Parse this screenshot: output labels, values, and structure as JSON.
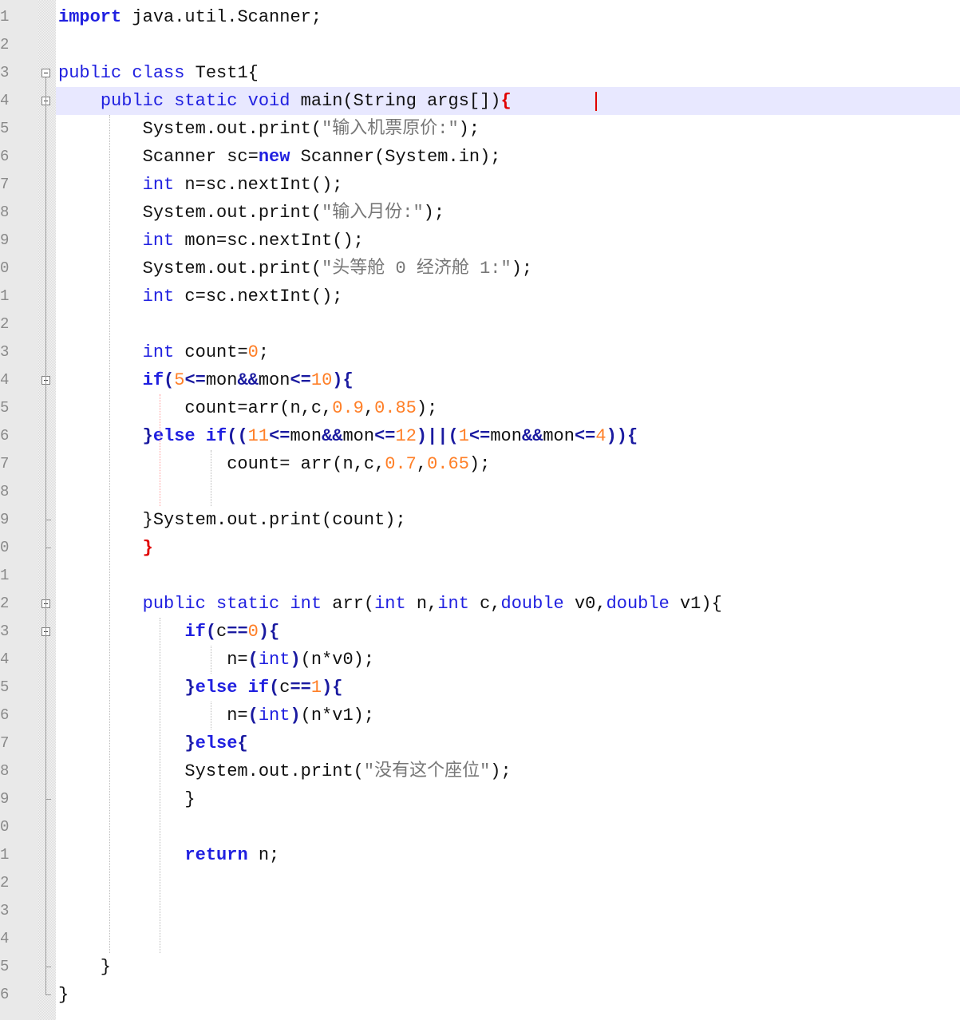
{
  "editor": {
    "current_line": 4,
    "lines": [
      {
        "n": "1",
        "tokens": [
          [
            "kw",
            "import"
          ],
          [
            "plain",
            " java.util.Scanner;"
          ]
        ]
      },
      {
        "n": "2",
        "tokens": []
      },
      {
        "n": "3",
        "tokens": [
          [
            "kw2",
            "public"
          ],
          [
            "plain",
            " "
          ],
          [
            "kw2",
            "class"
          ],
          [
            "plain",
            " Test1{"
          ]
        ]
      },
      {
        "n": "4",
        "tokens": [
          [
            "plain",
            "    "
          ],
          [
            "kw2",
            "public"
          ],
          [
            "plain",
            " "
          ],
          [
            "kw2",
            "static"
          ],
          [
            "plain",
            " "
          ],
          [
            "kw2",
            "void"
          ],
          [
            "plain",
            " main(String args[])"
          ],
          [
            "red",
            "{"
          ]
        ]
      },
      {
        "n": "5",
        "tokens": [
          [
            "plain",
            "        System.out.print("
          ],
          [
            "str",
            "\"输入机票原价:\""
          ],
          [
            "plain",
            ");"
          ]
        ]
      },
      {
        "n": "6",
        "tokens": [
          [
            "plain",
            "        Scanner sc="
          ],
          [
            "kw",
            "new"
          ],
          [
            "plain",
            " Scanner(System.in);"
          ]
        ]
      },
      {
        "n": "7",
        "tokens": [
          [
            "plain",
            "        "
          ],
          [
            "kw2",
            "int"
          ],
          [
            "plain",
            " n=sc.nextInt();"
          ]
        ]
      },
      {
        "n": "8",
        "tokens": [
          [
            "plain",
            "        System.out.print("
          ],
          [
            "str",
            "\"输入月份:\""
          ],
          [
            "plain",
            ");"
          ]
        ]
      },
      {
        "n": "9",
        "tokens": [
          [
            "plain",
            "        "
          ],
          [
            "kw2",
            "int"
          ],
          [
            "plain",
            " mon=sc.nextInt();"
          ]
        ]
      },
      {
        "n": "0",
        "tokens": [
          [
            "plain",
            "        System.out.print("
          ],
          [
            "str",
            "\"头等舱 0 经济舱 1:\""
          ],
          [
            "plain",
            ");"
          ]
        ]
      },
      {
        "n": "1",
        "tokens": [
          [
            "plain",
            "        "
          ],
          [
            "kw2",
            "int"
          ],
          [
            "plain",
            " c=sc.nextInt();"
          ]
        ]
      },
      {
        "n": "2",
        "tokens": []
      },
      {
        "n": "3",
        "tokens": [
          [
            "plain",
            "        "
          ],
          [
            "kw2",
            "int"
          ],
          [
            "plain",
            " count="
          ],
          [
            "num",
            "0"
          ],
          [
            "plain",
            ";"
          ]
        ]
      },
      {
        "n": "4",
        "tokens": [
          [
            "plain",
            "        "
          ],
          [
            "kw",
            "if"
          ],
          [
            "op",
            "("
          ],
          [
            "num",
            "5"
          ],
          [
            "op",
            "<="
          ],
          [
            "plain",
            "mon"
          ],
          [
            "op",
            "&&"
          ],
          [
            "plain",
            "mon"
          ],
          [
            "op",
            "<="
          ],
          [
            "num",
            "10"
          ],
          [
            "op",
            ")"
          ],
          [
            "op",
            "{"
          ]
        ]
      },
      {
        "n": "5",
        "tokens": [
          [
            "plain",
            "            count=arr(n,c,"
          ],
          [
            "num",
            "0.9"
          ],
          [
            "plain",
            ","
          ],
          [
            "num",
            "0.85"
          ],
          [
            "plain",
            ");"
          ]
        ]
      },
      {
        "n": "6",
        "tokens": [
          [
            "plain",
            "        "
          ],
          [
            "op",
            "}"
          ],
          [
            "kw",
            "else"
          ],
          [
            "plain",
            " "
          ],
          [
            "kw",
            "if"
          ],
          [
            "op",
            "(("
          ],
          [
            "num",
            "11"
          ],
          [
            "op",
            "<="
          ],
          [
            "plain",
            "mon"
          ],
          [
            "op",
            "&&"
          ],
          [
            "plain",
            "mon"
          ],
          [
            "op",
            "<="
          ],
          [
            "num",
            "12"
          ],
          [
            "op",
            ")||("
          ],
          [
            "num",
            "1"
          ],
          [
            "op",
            "<="
          ],
          [
            "plain",
            "mon"
          ],
          [
            "op",
            "&&"
          ],
          [
            "plain",
            "mon"
          ],
          [
            "op",
            "<="
          ],
          [
            "num",
            "4"
          ],
          [
            "op",
            "))"
          ],
          [
            "op",
            "{"
          ]
        ]
      },
      {
        "n": "7",
        "tokens": [
          [
            "plain",
            "                count= arr(n,c,"
          ],
          [
            "num",
            "0.7"
          ],
          [
            "plain",
            ","
          ],
          [
            "num",
            "0.65"
          ],
          [
            "plain",
            ");"
          ]
        ]
      },
      {
        "n": "8",
        "tokens": []
      },
      {
        "n": "9",
        "tokens": [
          [
            "plain",
            "        }System.out.print(count);"
          ]
        ]
      },
      {
        "n": "0",
        "tokens": [
          [
            "plain",
            "        "
          ],
          [
            "red",
            "}"
          ]
        ]
      },
      {
        "n": "1",
        "tokens": []
      },
      {
        "n": "2",
        "tokens": [
          [
            "plain",
            "        "
          ],
          [
            "kw2",
            "public"
          ],
          [
            "plain",
            " "
          ],
          [
            "kw2",
            "static"
          ],
          [
            "plain",
            " "
          ],
          [
            "kw2",
            "int"
          ],
          [
            "plain",
            " arr("
          ],
          [
            "kw2",
            "int"
          ],
          [
            "plain",
            " n,"
          ],
          [
            "kw2",
            "int"
          ],
          [
            "plain",
            " c,"
          ],
          [
            "kw2",
            "double"
          ],
          [
            "plain",
            " v0,"
          ],
          [
            "kw2",
            "double"
          ],
          [
            "plain",
            " v1){"
          ]
        ]
      },
      {
        "n": "3",
        "tokens": [
          [
            "plain",
            "            "
          ],
          [
            "kw",
            "if"
          ],
          [
            "op",
            "("
          ],
          [
            "plain",
            "c"
          ],
          [
            "op",
            "=="
          ],
          [
            "num",
            "0"
          ],
          [
            "op",
            ")"
          ],
          [
            "op",
            "{"
          ]
        ]
      },
      {
        "n": "4",
        "tokens": [
          [
            "plain",
            "                n="
          ],
          [
            "op",
            "("
          ],
          [
            "kw2",
            "int"
          ],
          [
            "op",
            ")"
          ],
          [
            "plain",
            "(n*v0);"
          ]
        ]
      },
      {
        "n": "5",
        "tokens": [
          [
            "plain",
            "            "
          ],
          [
            "op",
            "}"
          ],
          [
            "kw",
            "else"
          ],
          [
            "plain",
            " "
          ],
          [
            "kw",
            "if"
          ],
          [
            "op",
            "("
          ],
          [
            "plain",
            "c"
          ],
          [
            "op",
            "=="
          ],
          [
            "num",
            "1"
          ],
          [
            "op",
            ")"
          ],
          [
            "op",
            "{"
          ]
        ]
      },
      {
        "n": "6",
        "tokens": [
          [
            "plain",
            "                n="
          ],
          [
            "op",
            "("
          ],
          [
            "kw2",
            "int"
          ],
          [
            "op",
            ")"
          ],
          [
            "plain",
            "(n*v1);"
          ]
        ]
      },
      {
        "n": "7",
        "tokens": [
          [
            "plain",
            "            "
          ],
          [
            "op",
            "}"
          ],
          [
            "kw",
            "else"
          ],
          [
            "op",
            "{"
          ]
        ]
      },
      {
        "n": "8",
        "tokens": [
          [
            "plain",
            "            System.out.print("
          ],
          [
            "str",
            "\"没有这个座位\""
          ],
          [
            "plain",
            ");"
          ]
        ]
      },
      {
        "n": "9",
        "tokens": [
          [
            "plain",
            "            }"
          ]
        ]
      },
      {
        "n": "0",
        "tokens": []
      },
      {
        "n": "1",
        "tokens": [
          [
            "plain",
            "            "
          ],
          [
            "kw",
            "return"
          ],
          [
            "plain",
            " n;"
          ]
        ]
      },
      {
        "n": "2",
        "tokens": []
      },
      {
        "n": "3",
        "tokens": []
      },
      {
        "n": "4",
        "tokens": []
      },
      {
        "n": "5",
        "tokens": [
          [
            "plain",
            "    }"
          ]
        ]
      },
      {
        "n": "6",
        "tokens": [
          [
            "plain",
            "}"
          ]
        ]
      }
    ],
    "folds": [
      3,
      4,
      14,
      22,
      23
    ]
  }
}
